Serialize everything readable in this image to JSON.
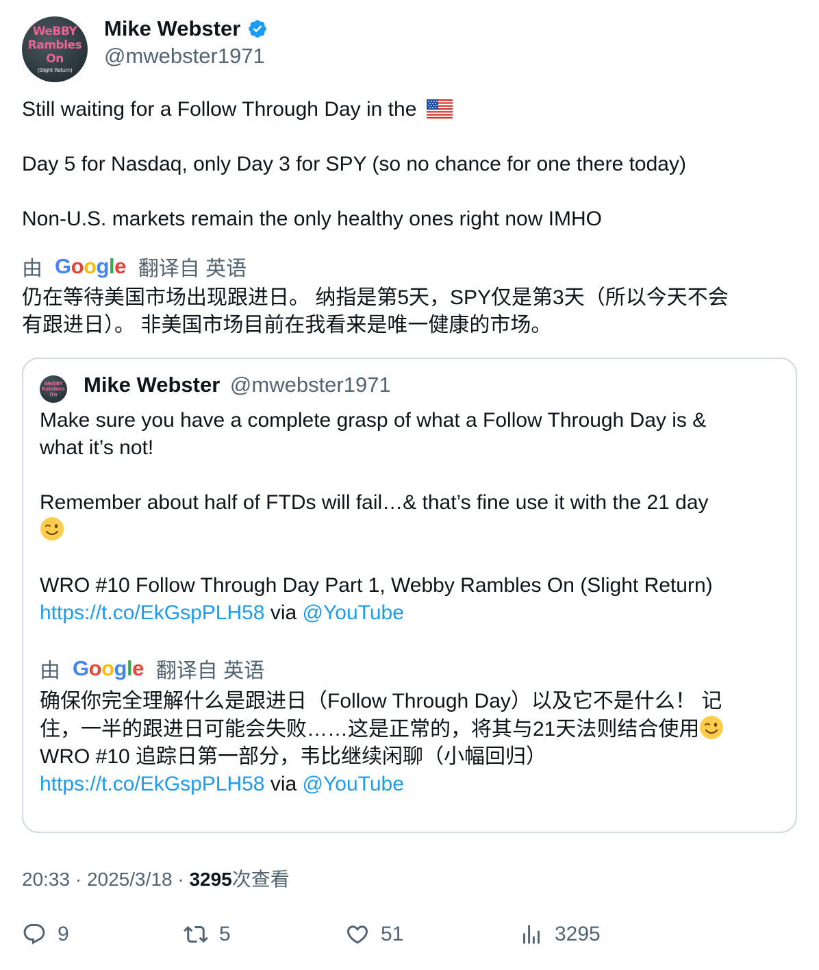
{
  "author": {
    "name": "Mike Webster",
    "handle": "@mwebster1971",
    "avatar_text": [
      "WeBBY",
      "Rambles",
      "On"
    ],
    "avatar_subtext": "(Slight Return)"
  },
  "tweet": {
    "line1": "Still waiting for a Follow Through Day in the",
    "line1_emoji": "us-flag-emoji",
    "line2": "Day 5 for Nasdaq, only Day 3 for SPY (so no chance for one there today)",
    "line3": "Non-U.S. markets remain the only healthy ones right now IMHO"
  },
  "translation": {
    "prefix": "由",
    "provider": "Google",
    "suffix": "翻译自 英语",
    "text_line1": "仍在等待美国市场出现跟进日。 纳指是第5天，SPY仅是第3天（所以今天不会",
    "text_line2": "有跟进日）。 非美国市场目前在我看来是唯一健康的市场。"
  },
  "quote": {
    "author_name": "Mike Webster",
    "author_handle": "@mwebster1971",
    "line1": "Make sure you have a complete grasp of what a Follow Through Day is &",
    "line2": "what it’s not!",
    "line3": "Remember about half of FTDs will fail…& that’s fine use it with the 21  day",
    "line4_emoji": "winking-face-emoji",
    "line5": "WRO #10 Follow Through Day Part 1, Webby Rambles On (Slight Return)",
    "link": "https://t.co/EkGspPLH58",
    "via": "via",
    "mention": "@YouTube",
    "translation": {
      "prefix": "由",
      "provider": "Google",
      "suffix": "翻译自 英语",
      "text_line1": "确保你完全理解什么是跟进日（Follow Through Day）以及它不是什么！ 记",
      "text_line2": "住，一半的跟进日可能会失败……这是正常的，将其与21天法则结合使用",
      "text_line3": "WRO #10 追踪日第一部分，韦比继续闲聊（小幅回归）",
      "link": "https://t.co/EkGspPLH58",
      "via": "via",
      "mention": "@YouTube"
    }
  },
  "meta": {
    "time": "20:33",
    "sep": "·",
    "date": "2025/3/18",
    "views_count": "3295",
    "views_label": "次查看"
  },
  "actions": {
    "replies": "9",
    "retweets": "5",
    "likes": "51",
    "views": "3295"
  },
  "colors": {
    "link": "#1d9bf0",
    "secondary": "#536471",
    "verified": "#1d9bf0"
  }
}
